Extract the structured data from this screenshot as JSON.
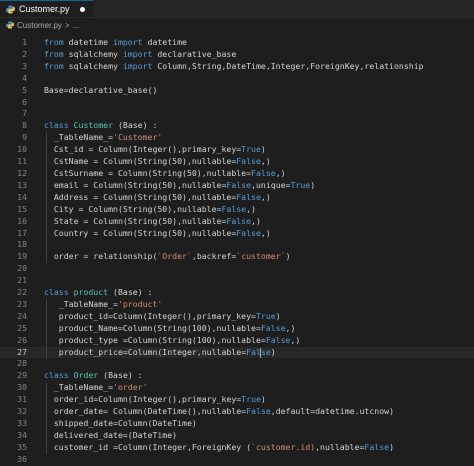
{
  "tab": {
    "title": "Customer.py",
    "icon": "python-file-icon",
    "modified": true
  },
  "breadcrumb": {
    "file": "Customer.py",
    "separator": ">",
    "rest": "..."
  },
  "colors": {
    "keyword": "#569cd6",
    "type": "#4ec9b0",
    "string": "#ce9178",
    "text": "#d4d4d4",
    "line_number": "#858585",
    "background": "#1e1e1e"
  },
  "active_line": 27,
  "lines": [
    {
      "n": "1",
      "t": [
        [
          "kw",
          "from"
        ],
        [
          "tx",
          " datetime "
        ],
        [
          "kw",
          "import"
        ],
        [
          "tx",
          " datetime"
        ]
      ]
    },
    {
      "n": "2",
      "t": [
        [
          "kw",
          "from"
        ],
        [
          "tx",
          " sqlalchemy "
        ],
        [
          "kw",
          "import"
        ],
        [
          "tx",
          " declarative_base"
        ]
      ]
    },
    {
      "n": "3",
      "t": [
        [
          "kw",
          "from"
        ],
        [
          "tx",
          " sqlalchemy "
        ],
        [
          "kw",
          "import"
        ],
        [
          "tx",
          " Column,String,DateTime,Integer,ForeignKey,relationship"
        ]
      ]
    },
    {
      "n": "4",
      "t": []
    },
    {
      "n": "5",
      "t": [
        [
          "tx",
          "Base=declarative_base()"
        ]
      ]
    },
    {
      "n": "6",
      "t": []
    },
    {
      "n": "7",
      "t": []
    },
    {
      "n": "8",
      "t": [
        [
          "kw",
          "class"
        ],
        [
          "tx",
          " "
        ],
        [
          "ty",
          "Customer"
        ],
        [
          "tx",
          " (Base) :"
        ]
      ]
    },
    {
      "n": "9",
      "t": [
        [
          "tx",
          "  _TableName_="
        ],
        [
          "st",
          "'Customer'"
        ]
      ]
    },
    {
      "n": "10",
      "t": [
        [
          "tx",
          "  Cst_id = Column(Integer(),primary_key="
        ],
        [
          "kw",
          "True"
        ],
        [
          "tx",
          ")"
        ]
      ]
    },
    {
      "n": "11",
      "t": [
        [
          "tx",
          "  CstName = Column(String(50),nullable="
        ],
        [
          "kw",
          "False"
        ],
        [
          "tx",
          ",)"
        ]
      ]
    },
    {
      "n": "12",
      "t": [
        [
          "tx",
          "  CstSurname = Column(String(50),nullable="
        ],
        [
          "kw",
          "False"
        ],
        [
          "tx",
          ",)"
        ]
      ]
    },
    {
      "n": "13",
      "t": [
        [
          "tx",
          "  email = Column(String(50),nullable="
        ],
        [
          "kw",
          "False"
        ],
        [
          "tx",
          ",unique="
        ],
        [
          "kw",
          "True"
        ],
        [
          "tx",
          ")"
        ]
      ]
    },
    {
      "n": "14",
      "t": [
        [
          "tx",
          "  Address = Column(String(50),nullable="
        ],
        [
          "kw",
          "False"
        ],
        [
          "tx",
          ",)"
        ]
      ]
    },
    {
      "n": "15",
      "t": [
        [
          "tx",
          "  City = Column(String(50),nullable="
        ],
        [
          "kw",
          "False"
        ],
        [
          "tx",
          ",)"
        ]
      ]
    },
    {
      "n": "16",
      "t": [
        [
          "tx",
          "  State = Column(String(50),nullable="
        ],
        [
          "kw",
          "False"
        ],
        [
          "tx",
          ",)"
        ]
      ]
    },
    {
      "n": "17",
      "t": [
        [
          "tx",
          "  Country = Column(String(50),nullable="
        ],
        [
          "kw",
          "False"
        ],
        [
          "tx",
          ",)"
        ]
      ]
    },
    {
      "n": "18",
      "t": []
    },
    {
      "n": "19",
      "t": [
        [
          "tx",
          "  order = relationship("
        ],
        [
          "st",
          "`Order`"
        ],
        [
          "tx",
          ",backref="
        ],
        [
          "st",
          "`customer`"
        ],
        [
          "tx",
          ")"
        ]
      ]
    },
    {
      "n": "20",
      "t": []
    },
    {
      "n": "21",
      "t": []
    },
    {
      "n": "22",
      "t": [
        [
          "kw",
          "class"
        ],
        [
          "tx",
          " "
        ],
        [
          "ty",
          "product"
        ],
        [
          "tx",
          " (Base) :"
        ]
      ]
    },
    {
      "n": "23",
      "t": [
        [
          "tx",
          "   _TableName_="
        ],
        [
          "st",
          "'product'"
        ]
      ]
    },
    {
      "n": "24",
      "t": [
        [
          "tx",
          "   product_id=Column(Integer(),primary_key="
        ],
        [
          "kw",
          "True"
        ],
        [
          "tx",
          ")"
        ]
      ]
    },
    {
      "n": "25",
      "t": [
        [
          "tx",
          "   product_Name=Column(String(100),nullable="
        ],
        [
          "kw",
          "False"
        ],
        [
          "tx",
          ",)"
        ]
      ]
    },
    {
      "n": "26",
      "t": [
        [
          "tx",
          "   product_type =Column(String(100),nullable="
        ],
        [
          "kw",
          "False"
        ],
        [
          "tx",
          ",)"
        ]
      ]
    },
    {
      "n": "27",
      "t": [
        [
          "tx",
          "   product_price=Column(Integer,nullable="
        ],
        [
          "kw",
          "False"
        ],
        [
          "tx",
          ")"
        ]
      ]
    },
    {
      "n": "28",
      "t": []
    },
    {
      "n": "29",
      "t": [
        [
          "kw",
          "class"
        ],
        [
          "tx",
          " "
        ],
        [
          "ty",
          "Order"
        ],
        [
          "tx",
          " (Base) :"
        ]
      ]
    },
    {
      "n": "30",
      "t": [
        [
          "tx",
          "  _TableName_="
        ],
        [
          "st",
          "'order'"
        ]
      ]
    },
    {
      "n": "31",
      "t": [
        [
          "tx",
          "  order_id=Column(Integer(),primary_key="
        ],
        [
          "kw",
          "True"
        ],
        [
          "tx",
          ")"
        ]
      ]
    },
    {
      "n": "32",
      "t": [
        [
          "tx",
          "  order_date= Column(DateTime(),nullable="
        ],
        [
          "kw",
          "False"
        ],
        [
          "tx",
          ",default=datetime.utcnow)"
        ]
      ]
    },
    {
      "n": "33",
      "t": [
        [
          "tx",
          "  shipped_date=Column(DateTime)"
        ]
      ]
    },
    {
      "n": "34",
      "t": [
        [
          "tx",
          "  delivered_date=(DateTime)"
        ]
      ]
    },
    {
      "n": "35",
      "t": [
        [
          "tx",
          "  customer_id =Column(Integer,ForeignKey ("
        ],
        [
          "st",
          "`customer.id)"
        ],
        [
          "tx",
          ",nullable="
        ],
        [
          "kw",
          "False"
        ],
        [
          "tx",
          ")"
        ]
      ]
    },
    {
      "n": "36",
      "t": []
    }
  ]
}
